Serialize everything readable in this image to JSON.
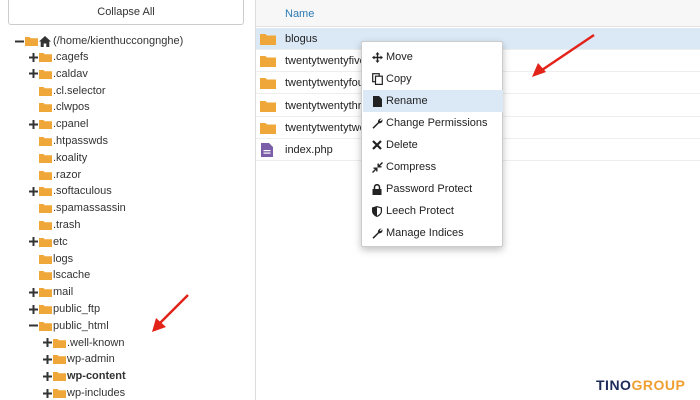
{
  "left": {
    "collapse_label": "Collapse All",
    "root_label": "(/home/kienthuccongnghe)",
    "tree": [
      {
        "label": ".cagefs",
        "toggle": "plus",
        "bold": false
      },
      {
        "label": ".caldav",
        "toggle": "plus",
        "bold": false
      },
      {
        "label": ".cl.selector",
        "toggle": "none",
        "bold": false
      },
      {
        "label": ".clwpos",
        "toggle": "none",
        "bold": false
      },
      {
        "label": ".cpanel",
        "toggle": "plus",
        "bold": false
      },
      {
        "label": ".htpasswds",
        "toggle": "none",
        "bold": false
      },
      {
        "label": ".koality",
        "toggle": "none",
        "bold": false
      },
      {
        "label": ".razor",
        "toggle": "none",
        "bold": false
      },
      {
        "label": ".softaculous",
        "toggle": "plus",
        "bold": false
      },
      {
        "label": ".spamassassin",
        "toggle": "none",
        "bold": false
      },
      {
        "label": ".trash",
        "toggle": "none",
        "bold": false
      },
      {
        "label": "etc",
        "toggle": "plus",
        "bold": false
      },
      {
        "label": "logs",
        "toggle": "none",
        "bold": false
      },
      {
        "label": "lscache",
        "toggle": "none",
        "bold": false
      },
      {
        "label": "mail",
        "toggle": "plus",
        "bold": false
      },
      {
        "label": "public_ftp",
        "toggle": "plus",
        "bold": false
      },
      {
        "label": "public_html",
        "toggle": "minus",
        "bold": false
      },
      {
        "label": ".well-known",
        "toggle": "plus",
        "bold": false
      },
      {
        "label": "wp-admin",
        "toggle": "plus",
        "bold": false
      },
      {
        "label": "wp-content",
        "toggle": "plus",
        "bold": true
      },
      {
        "label": "wp-includes",
        "toggle": "plus",
        "bold": false
      }
    ]
  },
  "right": {
    "header_name": "Name",
    "files": [
      {
        "name": "blogus",
        "type": "folder",
        "selected": true
      },
      {
        "name": "twentytwentyfive",
        "type": "folder",
        "selected": false
      },
      {
        "name": "twentytwentyfour",
        "type": "folder",
        "selected": false
      },
      {
        "name": "twentytwentythree",
        "type": "folder",
        "selected": false
      },
      {
        "name": "twentytwentytwo",
        "type": "folder",
        "selected": false
      },
      {
        "name": "index.php",
        "type": "file",
        "selected": false
      }
    ]
  },
  "context_menu": {
    "items": [
      {
        "label": "Move",
        "icon": "move-icon"
      },
      {
        "label": "Copy",
        "icon": "copy-icon"
      },
      {
        "label": "Rename",
        "icon": "file-icon",
        "highlighted": true
      },
      {
        "label": "Change Permissions",
        "icon": "wrench-icon"
      },
      {
        "label": "Delete",
        "icon": "close-icon"
      },
      {
        "label": "Compress",
        "icon": "compress-icon"
      },
      {
        "label": "Password Protect",
        "icon": "lock-icon"
      },
      {
        "label": "Leech Protect",
        "icon": "shield-icon"
      },
      {
        "label": "Manage Indices",
        "icon": "wrench-icon"
      }
    ]
  },
  "watermark": {
    "part1": "TINO",
    "part2": "GROUP"
  },
  "colors": {
    "folder": "#f0a73a",
    "accent_blue": "#2a7ab5",
    "selection": "#dbe9f7",
    "arrow": "#e2231a",
    "php_file": "#7b5ea7"
  }
}
